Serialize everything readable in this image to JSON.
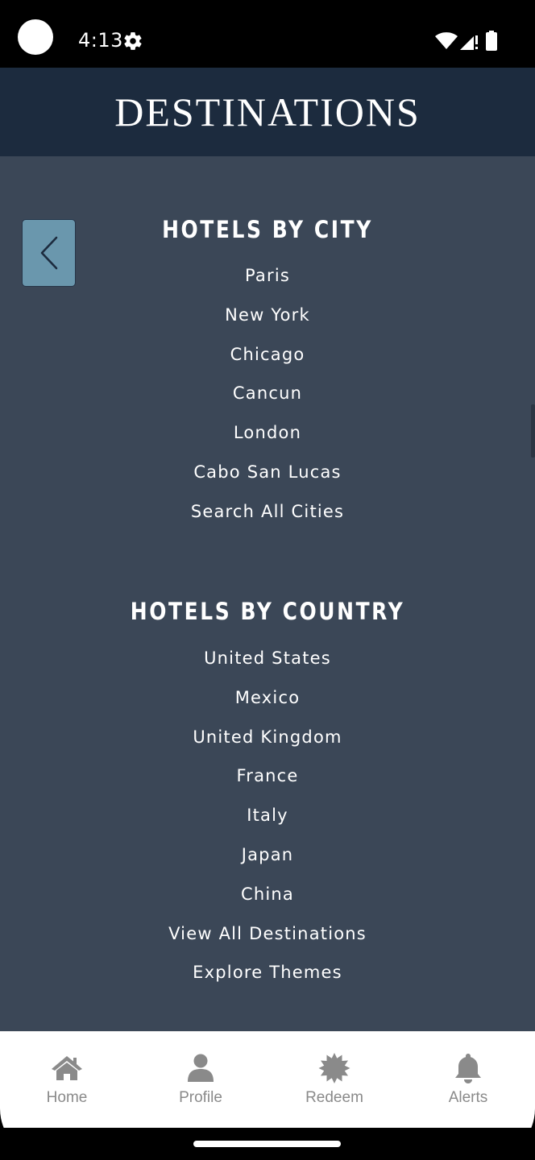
{
  "status_bar": {
    "time": "4:13"
  },
  "header": {
    "title": "DESTINATIONS"
  },
  "cities": {
    "heading": "HOTELS BY CITY",
    "items": [
      "Paris",
      "New York",
      "Chicago",
      "Cancun",
      "London",
      "Cabo San Lucas",
      "Search All Cities"
    ]
  },
  "countries": {
    "heading": "HOTELS BY COUNTRY",
    "items": [
      "United States",
      "Mexico",
      "United Kingdom",
      "France",
      "Italy",
      "Japan",
      "China",
      "View All Destinations",
      "Explore Themes"
    ]
  },
  "bottom_nav": {
    "items": [
      {
        "label": "Home",
        "icon": "home-icon"
      },
      {
        "label": "Profile",
        "icon": "profile-icon"
      },
      {
        "label": "Redeem",
        "icon": "redeem-icon"
      },
      {
        "label": "Alerts",
        "icon": "bell-icon"
      }
    ]
  },
  "colors": {
    "header_bg": "#1c2b3e",
    "content_bg": "#3b4757",
    "back_button_bg": "#6a97ad",
    "nav_icon": "#8a8a8a"
  }
}
